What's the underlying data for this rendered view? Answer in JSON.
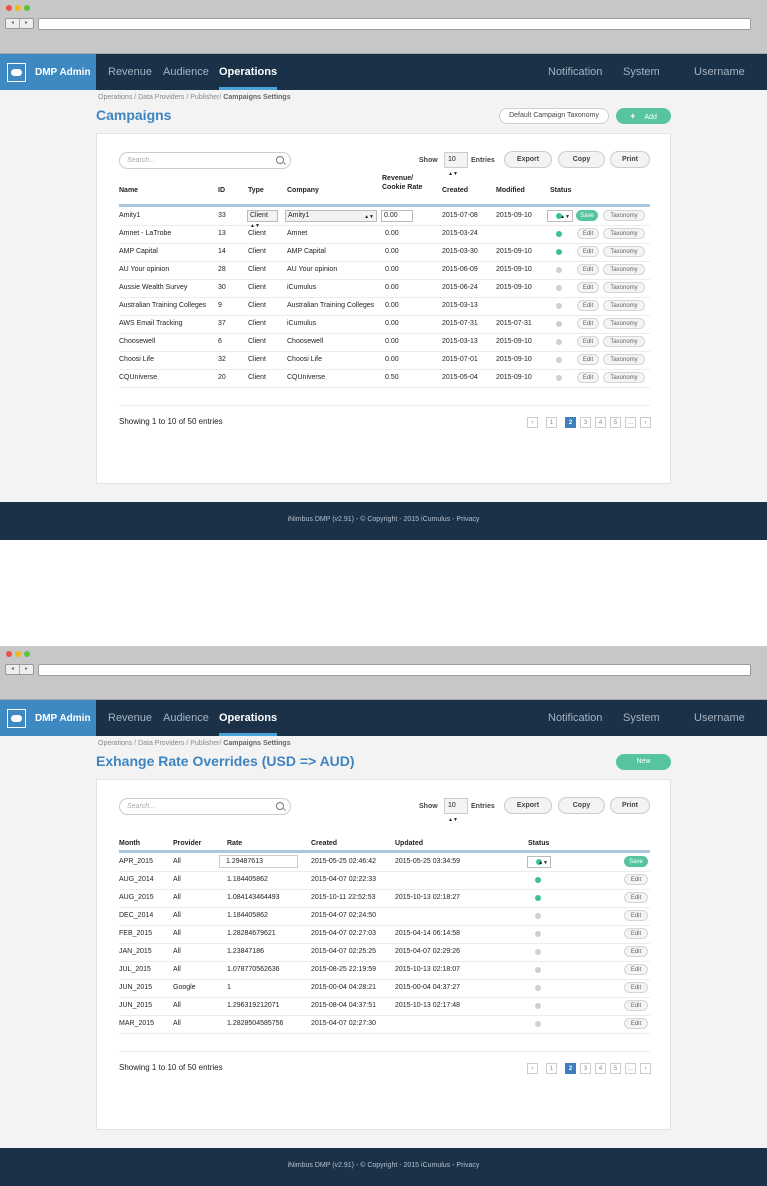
{
  "nav": {
    "brand": "DMP Admin",
    "items": [
      "Revenue",
      "Audience",
      "Operations"
    ],
    "right_items": [
      "Notification",
      "System",
      "Username"
    ]
  },
  "common": {
    "search_placeholder": "Search...",
    "show_label": "Show",
    "entries_label": "Entries",
    "page_size": "10",
    "export": "Export",
    "copy": "Copy",
    "print": "Print",
    "showing": "Showing 1 to 10 of 50 entries",
    "pages": [
      "‹",
      "1",
      "2",
      "3",
      "4",
      "5",
      "...",
      "›"
    ],
    "active_page": "2",
    "footer": "iNimbus DMP (v2.91) - © Copyright - 2015 iCumulus - Privacy"
  },
  "shot1": {
    "crumbs": "Operations / Data Providers  / Publisher/",
    "crumb_current": "Campaigns Settings",
    "title": "Campaigns",
    "btn_taxonomy": "Default Campaign Taxonomy",
    "btn_add": "Add",
    "columns": [
      "Name",
      "ID",
      "Type",
      "Company",
      "Revenue/",
      "Cookie Rate",
      "Created",
      "Modified",
      "Status"
    ],
    "row_actions": {
      "save": "Save",
      "edit": "Edit",
      "taxonomy": "Taxonomy"
    },
    "rows": [
      {
        "name": "Amity1",
        "id": "33",
        "type": "Client",
        "company": "Amity1",
        "rate": "0.00",
        "created": "2015-07-08",
        "modified": "2015-09-10",
        "status": "active",
        "editing": true
      },
      {
        "name": "Amnet - LaTrobe",
        "id": "13",
        "type": "Client",
        "company": "Amnet",
        "rate": "0.00",
        "created": "2015-03-24",
        "modified": "",
        "status": "active"
      },
      {
        "name": "AMP Capital",
        "id": "14",
        "type": "Client",
        "company": "AMP Capital",
        "rate": "0.00",
        "created": "2015-03-30",
        "modified": "2015-09-10",
        "status": "active"
      },
      {
        "name": "AU Your opinion",
        "id": "28",
        "type": "Client",
        "company": "AU Your opinion",
        "rate": "0.00",
        "created": "2015-06-09",
        "modified": "2015-09-10",
        "status": "inactive"
      },
      {
        "name": "Aussie Wealth Survey",
        "id": "30",
        "type": "Client",
        "company": "iCumulus",
        "rate": "0.00",
        "created": "2015-06-24",
        "modified": "2015-09-10",
        "status": "inactive"
      },
      {
        "name": "Australian Training Colleges",
        "id": "9",
        "type": "Client",
        "company": "Australian Training Colleges",
        "rate": "0.00",
        "created": "2015-03-13",
        "modified": "",
        "status": "inactive"
      },
      {
        "name": "AWS Email Tracking",
        "id": "37",
        "type": "Client",
        "company": "iCumulus",
        "rate": "0.00",
        "created": "2015-07-31",
        "modified": "2015-07-31",
        "status": "inactive"
      },
      {
        "name": "Choosewell",
        "id": "6",
        "type": "Client",
        "company": "Choosewell",
        "rate": "0.00",
        "created": "2015-03-13",
        "modified": "2015-09-10",
        "status": "inactive"
      },
      {
        "name": "Choosi Life",
        "id": "32",
        "type": "Client",
        "company": "Choosi Life",
        "rate": "0.00",
        "created": "2015-07-01",
        "modified": "2015-09-10",
        "status": "inactive"
      },
      {
        "name": "CQUniverse",
        "id": "20",
        "type": "Client",
        "company": "CQUniverse",
        "rate": "0.50",
        "created": "2015-05-04",
        "modified": "2015-09-10",
        "status": "inactive"
      }
    ]
  },
  "shot2": {
    "crumbs": "Operations / Data Providers  / Publisher/",
    "crumb_current": "Campaigns Settings",
    "title": "Exhange Rate Overrides (USD => AUD)",
    "btn_new": "New",
    "columns": [
      "Month",
      "Provider",
      "Rate",
      "Created",
      "Updated",
      "Status"
    ],
    "row_actions": {
      "save": "Save",
      "edit": "Edit"
    },
    "rows": [
      {
        "month": "APR_2015",
        "provider": "All",
        "rate": "1.29487613",
        "created": "2015-05-25 02:46:42",
        "updated": "2015-05-25 03:34:59",
        "status": "active",
        "editing": true
      },
      {
        "month": "AUG_2014",
        "provider": "All",
        "rate": "1.184405862",
        "created": "2015-04-07 02:22:33",
        "updated": "",
        "status": "active"
      },
      {
        "month": "AUG_2015",
        "provider": "All",
        "rate": "1.084143464493",
        "created": "2015-10-11 22:52:53",
        "updated": "2015-10-13 02:18:27",
        "status": "active"
      },
      {
        "month": "DEC_2014",
        "provider": "All",
        "rate": "1.184405862",
        "created": "2015-04-07 02:24:50",
        "updated": "",
        "status": "inactive"
      },
      {
        "month": "FEB_2015",
        "provider": "All",
        "rate": "1.28284679621",
        "created": "2015-04-07 02:27:03",
        "updated": "2015-04-14 06:14:58",
        "status": "inactive"
      },
      {
        "month": "JAN_2015",
        "provider": "All",
        "rate": "1.23847186",
        "created": "2015-04-07 02:25:25",
        "updated": "2015-04-07 02:29:26",
        "status": "inactive"
      },
      {
        "month": "JUL_2015",
        "provider": "All",
        "rate": "1.078770562636",
        "created": "2015-08-25 22:19:59",
        "updated": "2015-10-13 02:18:07",
        "status": "inactive"
      },
      {
        "month": "JUN_2015",
        "provider": "Google",
        "rate": "1",
        "created": "2015-00-04 04:28:21",
        "updated": "2015-00-04 04:37:27",
        "status": "inactive"
      },
      {
        "month": "JUN_2015",
        "provider": "All",
        "rate": "1.296319212071",
        "created": "2015-08-04 04:37:51",
        "updated": "2015-10-13 02:17:48",
        "status": "inactive"
      },
      {
        "month": "MAR_2015",
        "provider": "All",
        "rate": "1.2828504585756",
        "created": "2015-04-07 02:27:30",
        "updated": "",
        "status": "inactive"
      }
    ]
  },
  "colors": {
    "nav_bg": "#1b3148",
    "brand_bg": "#3f89c3",
    "accent_green": "#56c4a1",
    "title_blue": "#3e84c0",
    "status_active": "#3cc193",
    "status_inactive": "#cfcfcf"
  },
  "icons": [
    "logo-icon",
    "search-icon",
    "plus-icon",
    "sort-arrows-icon",
    "back-icon",
    "forward-icon"
  ]
}
